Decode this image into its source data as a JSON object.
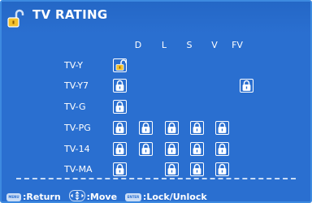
{
  "header": {
    "title": "TV RATING"
  },
  "columns": [
    "D",
    "L",
    "S",
    "V",
    "FV"
  ],
  "rows": [
    {
      "label": "TV-Y",
      "locks": [
        true,
        false,
        false,
        false,
        false,
        false
      ],
      "selected": 0
    },
    {
      "label": "TV-Y7",
      "locks": [
        true,
        false,
        false,
        false,
        false,
        true
      ]
    },
    {
      "label": "TV-G",
      "locks": [
        true,
        false,
        false,
        false,
        false,
        false
      ]
    },
    {
      "label": "TV-PG",
      "locks": [
        true,
        true,
        true,
        true,
        true,
        false
      ]
    },
    {
      "label": "TV-14",
      "locks": [
        true,
        true,
        true,
        true,
        true,
        false
      ]
    },
    {
      "label": "TV-MA",
      "locks": [
        true,
        false,
        true,
        true,
        true,
        false
      ]
    }
  ],
  "footer": {
    "menu_key": "MENU",
    "return_label": ":Return",
    "move_label": ":Move",
    "enter_key": "ENTER",
    "lock_label": ":Lock/Unlock"
  },
  "colors": {
    "background": "#2a6fd0",
    "selected_lock": "#f3c12b",
    "lock_border": "#ffffff"
  }
}
